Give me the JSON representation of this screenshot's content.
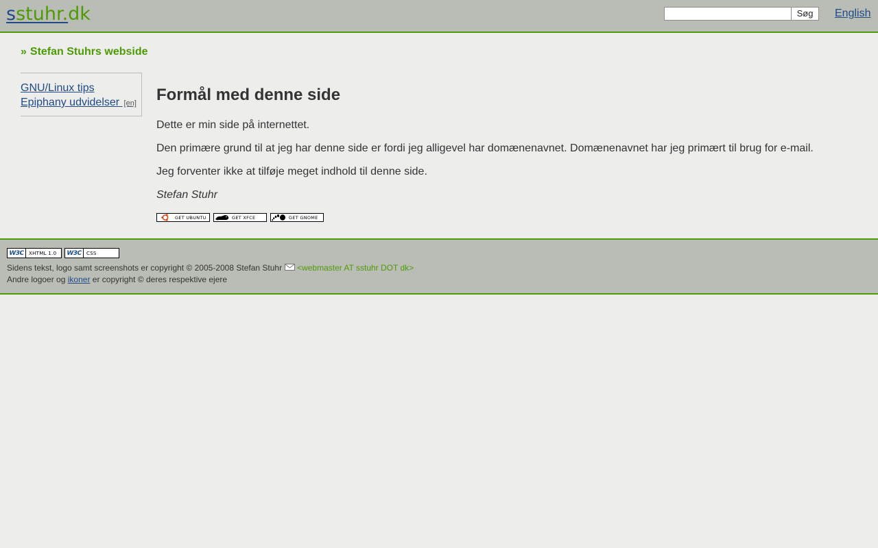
{
  "header": {
    "logo_part1": "s",
    "logo_part2": "stuhr.",
    "logo_part3": "dk",
    "search_value": "",
    "search_button_label": "Søg",
    "language_link": "English"
  },
  "breadcrumb": {
    "separator": "»",
    "label": "Stefan Stuhrs webside"
  },
  "sidebar": {
    "items": [
      {
        "label": "GNU/Linux tips",
        "tag": ""
      },
      {
        "label": "Epiphany udvidelser",
        "tag": "[en]"
      }
    ]
  },
  "main": {
    "title": "Formål med denne side",
    "paragraphs": [
      "Dette er min side på internettet.",
      "Den primære grund til at jeg har denne side er fordi jeg alligevel har domænenavnet. Domænenavnet har jeg primært til brug for e-mail.",
      "Jeg forventer ikke at tilføje meget indhold til denne side."
    ],
    "signature": "Stefan Stuhr",
    "badges": [
      {
        "label": "GET UBUNTU",
        "icon": "ubuntu-icon"
      },
      {
        "label": "GET XFCE",
        "icon": "xfce-mouse-icon"
      },
      {
        "label": "GET GNOME",
        "icon": "gnome-foot-icon"
      }
    ]
  },
  "footer": {
    "valid_badges": [
      {
        "brand": "W3C",
        "label": "XHTML 1.0"
      },
      {
        "brand": "W3C",
        "label": "CSS"
      }
    ],
    "copyright_text": "Sidens tekst, logo samt screenshots er copyright © 2005-2008 Stefan Stuhr",
    "email_text": "<webmaster AT sstuhr DOT dk>",
    "line2_prefix": "Andre logoer og",
    "line2_link": "ikoner",
    "line2_suffix": "er copyright © deres respektive ejere"
  },
  "colors": {
    "background": "#ededeb",
    "header_bg": "#babdb6",
    "accent_green": "#4e9a06",
    "link_blue": "#204a87",
    "text": "#333333"
  }
}
